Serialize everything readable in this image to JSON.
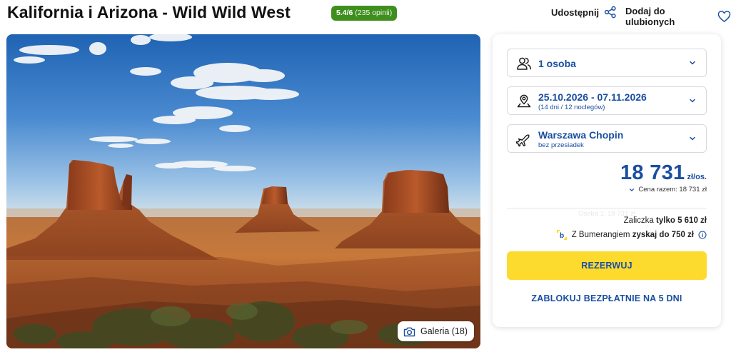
{
  "header": {
    "title": "Kalifornia i Arizona - Wild Wild West",
    "rating_score": "5.4/6",
    "rating_count": "(235 opinii)",
    "share_label": "Udostępnij",
    "favorite_label": "Dodaj do ulubionych"
  },
  "gallery": {
    "label": "Galeria (18)",
    "icon": "camera-icon"
  },
  "booking": {
    "persons": {
      "label": "1 osoba",
      "icon": "people-icon"
    },
    "dates": {
      "label": "25.10.2026 - 07.11.2026",
      "sub": "(14 dni / 12 noclegów)",
      "icon": "map-pin-icon"
    },
    "departure": {
      "label": "Warszawa Chopin",
      "sub": "bez przesiadek",
      "icon": "plane-icon"
    },
    "price": {
      "amount": "18 731",
      "unit": "zł/os.",
      "total": "Cena razem: 18 731 zł",
      "ghost": "Osoba 1: 18 731 zł"
    },
    "deposit": {
      "prefix": "Zaliczka ",
      "strong": "tylko 5 610 zł"
    },
    "bumerang": {
      "prefix": "Z Bumerangiem ",
      "strong": "zyskaj do 750 zł"
    },
    "reserve_label": "REZERWUJ",
    "block_label": "ZABLOKUJ BEZPŁATNIE NA 5 DNI"
  },
  "colors": {
    "primary": "#1a4fa0",
    "accent": "#fddb2e",
    "rating_bg": "#3f8f1e"
  }
}
